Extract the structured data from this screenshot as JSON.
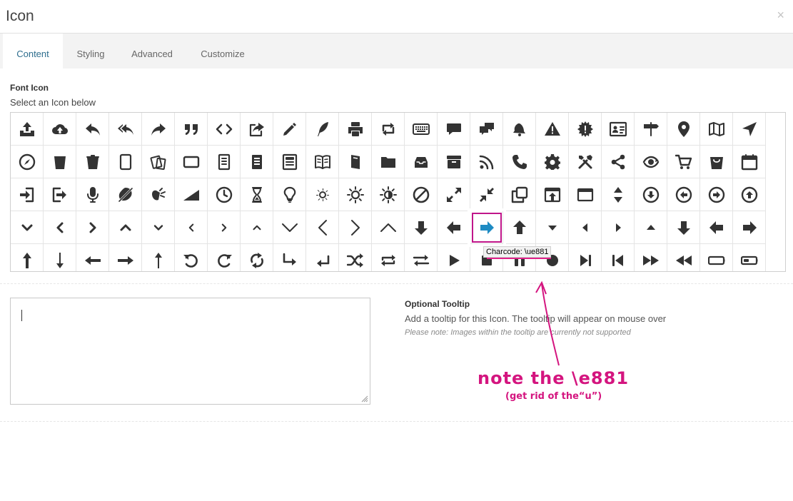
{
  "window": {
    "title": "Icon",
    "close_glyph": "×"
  },
  "tabs": [
    {
      "label": "Content",
      "active": true
    },
    {
      "label": "Styling",
      "active": false
    },
    {
      "label": "Advanced",
      "active": false
    },
    {
      "label": "Customize",
      "active": false
    }
  ],
  "font_icon": {
    "label": "Font Icon",
    "description": "Select an Icon below",
    "selected_icon": "arrow-right-fat-icon",
    "tooltip_text": "Charcode: \\ue881",
    "rows": [
      [
        "upload-tray-icon",
        "cloud-upload-icon",
        "reply-icon",
        "reply-all-icon",
        "forward-icon",
        "quote-icon",
        "code-icon",
        "share-box-icon",
        "pencil-icon",
        "feather-icon",
        "printer-icon",
        "retweet-icon",
        "keyboard-icon",
        "chat-bubble-icon",
        "chat-bubbles-icon",
        "bell-icon",
        "warning-icon",
        "alert-badge-icon",
        "vcard-icon",
        "signpost-icon",
        "location-pin-icon",
        "map-icon",
        "navigation-arrow-icon"
      ],
      [
        "compass-icon",
        "cup-icon",
        "trash-icon",
        "tablet-icon",
        "documents-icon",
        "monitor-icon",
        "document-icon",
        "document-text-icon",
        "newspaper-icon",
        "open-book-icon",
        "book-icon",
        "folder-icon",
        "inbox-icon",
        "archive-icon",
        "rss-icon",
        "phone-icon",
        "gear-icon",
        "tools-icon",
        "share-icon",
        "eye-sync-icon",
        "cart-icon",
        "shopping-bag-icon",
        "calendar-icon"
      ],
      [
        "login-icon",
        "logout-icon",
        "microphone-icon",
        "mute-icon",
        "volume-icon",
        "signal-icon",
        "clock-icon",
        "hourglass-icon",
        "lightbulb-icon",
        "brightness-low-icon",
        "brightness-high-icon",
        "contrast-icon",
        "block-icon",
        "expand-icon",
        "collapse-icon",
        "duplicate-icon",
        "browser-upload-icon",
        "browser-icon",
        "up-down-icon",
        "circle-down-icon",
        "circle-left-icon",
        "circle-right-icon",
        "circle-up-icon"
      ],
      [
        "chevron-down-bold-icon",
        "chevron-left-bold-icon",
        "chevron-right-bold-icon",
        "chevron-up-bold-icon",
        "chevron-down-small-icon",
        "chevron-left-small-icon",
        "chevron-right-small-icon",
        "chevron-up-small-icon",
        "chevron-down-thin-icon",
        "chevron-left-thin-icon",
        "chevron-right-thin-icon",
        "chevron-up-thin-icon",
        "arrow-down-fat-icon",
        "arrow-left-fat-icon",
        "arrow-right-fat-icon",
        "arrow-up-fat-icon",
        "caret-down-icon",
        "caret-left-icon",
        "caret-right-icon",
        "caret-up-icon",
        "arrow-down-bold-icon",
        "arrow-left-bold-icon",
        "arrow-right-bold-icon"
      ],
      [
        "arrow-up-long-icon",
        "arrow-down-long-icon",
        "arrow-left-long-icon",
        "arrow-right-long-icon",
        "arrow-up-thin-long-icon",
        "rotate-ccw-icon",
        "rotate-cw-icon",
        "sync-icon",
        "turn-right-icon",
        "turn-left-icon",
        "shuffle-icon",
        "loop-icon",
        "swap-icon",
        "play-icon",
        "stop-icon",
        "pause-icon",
        "record-icon",
        "next-icon",
        "previous-icon",
        "fast-forward-icon",
        "rewind-icon",
        "battery-empty-icon",
        "battery-low-icon"
      ]
    ]
  },
  "tooltip_field": {
    "value": "",
    "label": "Optional Tooltip",
    "description": "Add a tooltip for this Icon. The tooltip will appear on mouse over",
    "note": "Please note: Images within the tooltip are currently not supported"
  },
  "annotation": {
    "main": "note  the   \\e881",
    "sub": "(get rid of the“u”)",
    "color": "#d4157f"
  },
  "colors": {
    "accent": "#2e6e8e",
    "icon": "#333333",
    "selected_icon": "#1e8bc3",
    "selection_outline": "#c0168a"
  }
}
